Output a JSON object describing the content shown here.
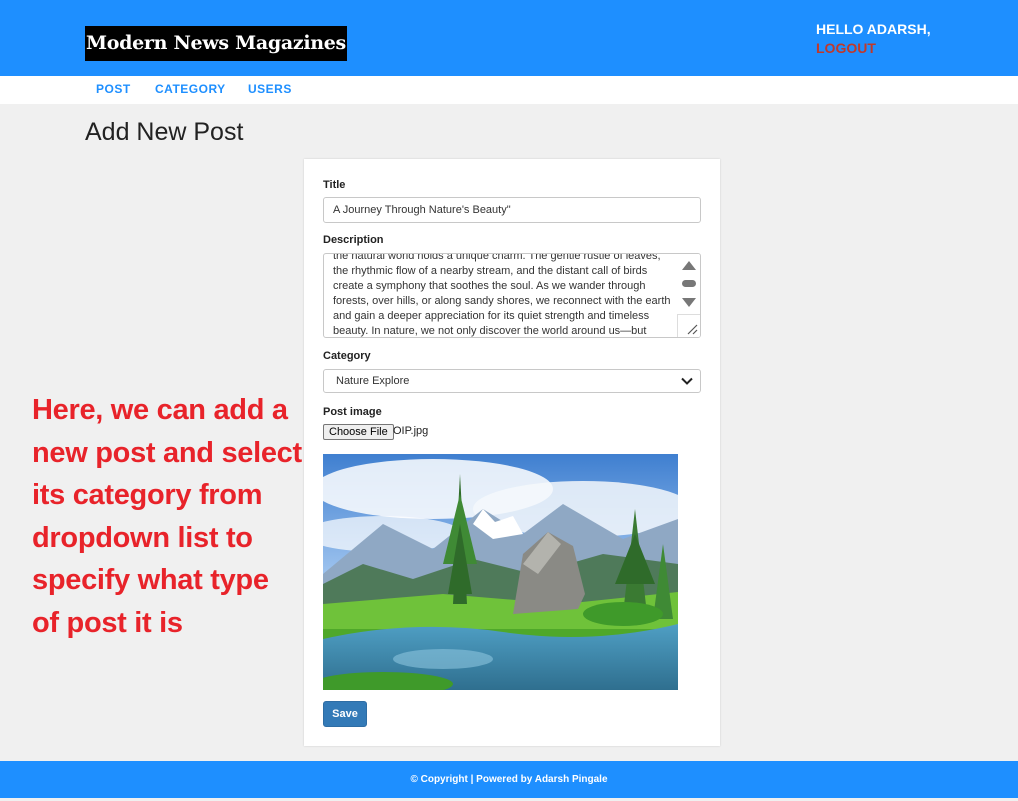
{
  "header": {
    "logo_text": "Modern News Magazines",
    "greeting": "HELLO ADARSH,",
    "logout_label": "LOGOUT"
  },
  "nav": {
    "items": [
      {
        "label": "POST"
      },
      {
        "label": "CATEGORY"
      },
      {
        "label": "USERS"
      }
    ]
  },
  "page": {
    "title": "Add New Post"
  },
  "form": {
    "title_label": "Title",
    "title_value": "A Journey Through Nature's Beauty\"",
    "description_label": "Description",
    "description_value": "the natural world holds a unique charm. The gentle rustle of leaves, the rhythmic flow of a nearby stream, and the distant call of birds create a symphony that soothes the soul. As we wander through forests, over hills, or along sandy shores, we reconnect with the earth and gain a deeper appreciation for its quiet strength and timeless beauty. In nature, we not only discover the world around us—but often, we rediscover",
    "category_label": "Category",
    "category_selected": "Nature Explore",
    "image_label": "Post image",
    "file_button_label": "Choose File",
    "file_name": "OIP.jpg",
    "save_label": "Save"
  },
  "annotation": {
    "text": "Here, we can add a new post and select its category from dropdown list to specify what type of post it is"
  },
  "footer": {
    "text": "© Copyright | Powered by Adarsh Pingale"
  },
  "colors": {
    "header_bg": "#1e8fff",
    "logout": "#c0392b",
    "annotation": "#e8232a",
    "save_button": "#337ab7"
  }
}
